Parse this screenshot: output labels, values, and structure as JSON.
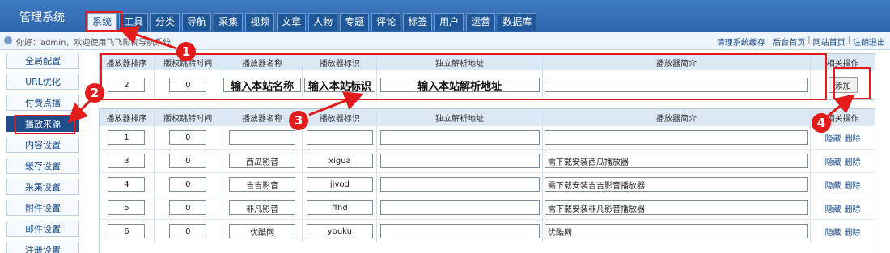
{
  "app_title": "管理系统",
  "nav": [
    "系统",
    "工具",
    "分类",
    "导航",
    "采集",
    "视频",
    "文章",
    "人物",
    "专题",
    "评论",
    "标签",
    "用户",
    "运营",
    "数据库"
  ],
  "welcome": "你好：admin，欢迎使用飞飞影视导航系统",
  "top_links": [
    "清理系统缓存",
    "后台首页",
    "网站首页",
    "注销退出"
  ],
  "sidebar": [
    "全局配置",
    "URL优化",
    "付费点播",
    "播放来源",
    "内容设置",
    "缓存设置",
    "采集设置",
    "附件设置",
    "邮件设置",
    "注册设置"
  ],
  "headers": [
    "播放器排序",
    "版权跳转时间",
    "播放器名称",
    "播放器标识",
    "独立解析地址",
    "播放器简介",
    "相关操作"
  ],
  "add_row": {
    "sort": "2",
    "time": "0",
    "name": "输入本站名称",
    "flag": "输入本站标识",
    "parse": "输入本站解析地址",
    "intro": "",
    "button": "添加"
  },
  "rows": [
    {
      "sort": "1",
      "time": "0",
      "name": "",
      "flag": "",
      "parse": "",
      "intro": ""
    },
    {
      "sort": "3",
      "time": "0",
      "name": "西瓜影音",
      "flag": "xigua",
      "parse": "",
      "intro": "需下载安装西瓜播放器"
    },
    {
      "sort": "4",
      "time": "0",
      "name": "吉吉影音",
      "flag": "jjvod",
      "parse": "",
      "intro": "需下载安装吉吉影音播放器"
    },
    {
      "sort": "5",
      "time": "0",
      "name": "非凡影音",
      "flag": "ffhd",
      "parse": "",
      "intro": "需下载安装非凡影音播放器"
    },
    {
      "sort": "6",
      "time": "0",
      "name": "优酷网",
      "flag": "youku",
      "parse": "",
      "intro": "优酷网"
    }
  ],
  "row_ops": [
    "隐藏",
    "删除"
  ],
  "markers": [
    "1",
    "2",
    "3",
    "4"
  ],
  "colors": {
    "header_blue": "#2d66ad",
    "annotation_red": "#e31b1b",
    "sidebar_active": "#1f4d8a"
  }
}
